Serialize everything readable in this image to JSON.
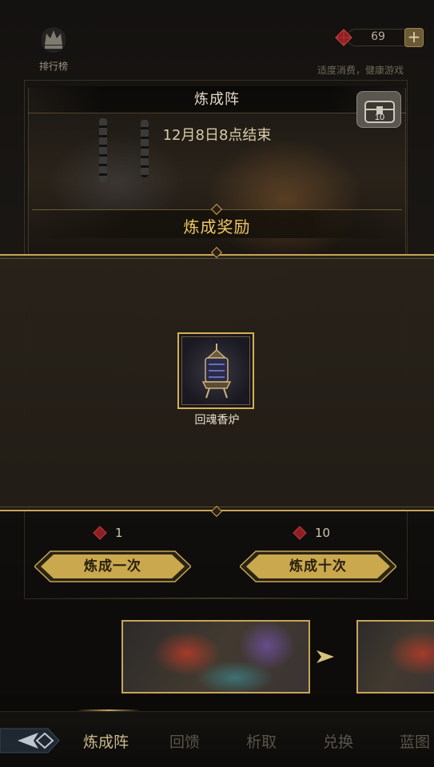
{
  "header": {
    "rank_label": "排行榜",
    "currency_value": "69",
    "currency_add": "+",
    "notice": "适度消费，健康游戏"
  },
  "banner": {
    "title": "炼成阵",
    "end_time": "12月8日8点结束"
  },
  "reward": {
    "section_title": "炼成奖励",
    "item_name": "回魂香炉"
  },
  "actions": {
    "single": {
      "cost": "1",
      "label": "炼成一次"
    },
    "ten": {
      "cost": "10",
      "label": "炼成十次"
    }
  },
  "nav": {
    "tabs": [
      {
        "label": "炼成阵",
        "active": true
      },
      {
        "label": "回馈",
        "active": false
      },
      {
        "label": "析取",
        "active": false
      },
      {
        "label": "兑换",
        "active": false
      },
      {
        "label": "蓝图",
        "active": false
      }
    ]
  },
  "colors": {
    "gold": "#c9a559",
    "reward_title": "#f0c962",
    "gem_red": "#b3262a"
  },
  "icons": [
    "crown-icon",
    "gem-icon",
    "plus-icon",
    "chest-icon",
    "back-arrow-icon",
    "next-arrow-icon"
  ]
}
